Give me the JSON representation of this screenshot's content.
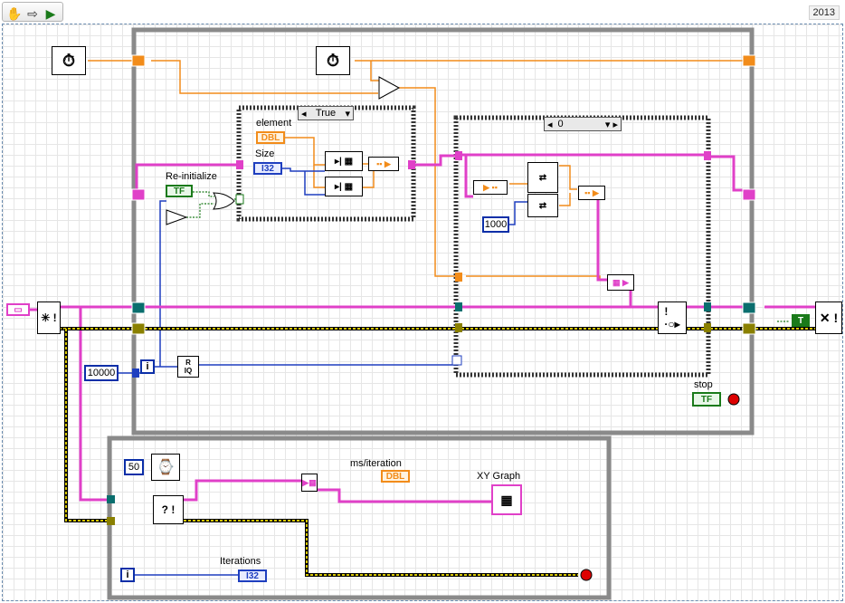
{
  "toolbar": {
    "run_tool_icon": "hand-icon",
    "arrow_tool_icon": "arrow-icon",
    "highlight_icon": "lightbulb-icon",
    "version": "2013"
  },
  "labels": {
    "element": "element",
    "size": "Size",
    "reinit": "Re-initialize",
    "stop": "stop",
    "ms_iter": "ms/iteration",
    "xy_graph": "XY Graph",
    "iterations": "Iterations"
  },
  "case_structures": {
    "upper_selector": "True",
    "right_selector": "0"
  },
  "constants": {
    "total_iterations": "10000",
    "array_size": "1000",
    "wait_ms": "50",
    "loop_i_upper": "i",
    "loop_i_lower": "i",
    "bool_true": "T"
  },
  "terminals": {
    "element_type": "DBL",
    "size_type": "I32",
    "reinit_type": "TF",
    "stop_type": "TF",
    "ms_iter_type": "DBL",
    "iterations_type": "I32",
    "quotient_label_r": "R",
    "quotient_label_iq": "IQ"
  },
  "colors": {
    "orange_wire": "#f28c1a",
    "pink_wire": "#e040c8",
    "blue_wire": "#1f3fbf",
    "green_wire": "#1a7a1a",
    "error_wire": "#c8b400",
    "loop_frame": "#888888"
  }
}
